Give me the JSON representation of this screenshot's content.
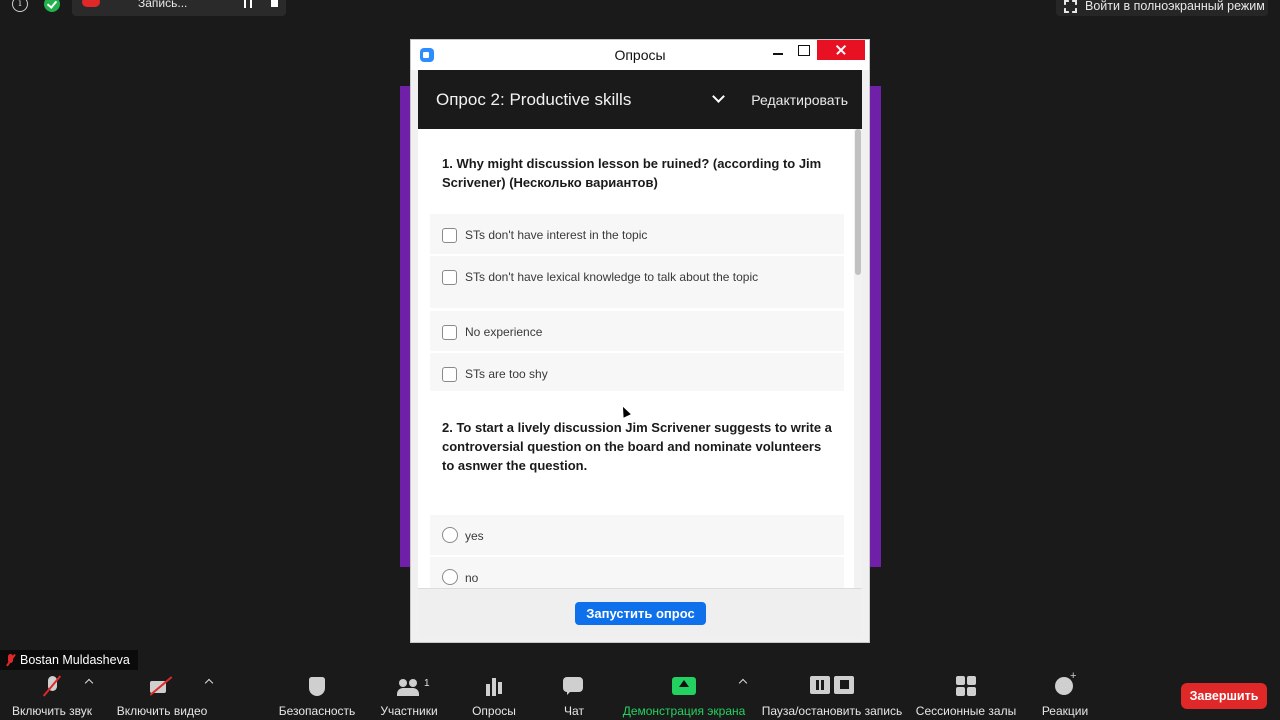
{
  "top_bar": {
    "recording_label": "Запись...",
    "fullscreen_label": "Войти в полноэкранный режим"
  },
  "poll_window": {
    "window_title": "Опросы",
    "poll_name": "Опрос 2: Productive skills",
    "edit_label": "Редактировать",
    "questions": [
      {
        "text": "1. Why might discussion lesson  be ruined? (according to Jim Scrivener) (Несколько вариантов)",
        "type": "multiple",
        "options": [
          "STs don't have interest in the topic",
          "STs don't have lexical knowledge to talk about the topic",
          "No experience",
          "STs are too shy"
        ]
      },
      {
        "text": "2. To start a lively discussion Jim Scrivener suggests to write a controversial question on the board and nominate volunteers to asnwer the question.",
        "type": "single",
        "options": [
          "yes",
          "no"
        ]
      }
    ],
    "launch_button": "Запустить опрос"
  },
  "participant": {
    "name": "Bostan Muldasheva"
  },
  "toolbar": {
    "audio": "Включить звук",
    "video": "Включить видео",
    "security": "Безопасность",
    "participants": "Участники",
    "participants_count": "1",
    "polls": "Опросы",
    "chat": "Чат",
    "share_screen": "Демонстрация экрана",
    "record": "Пауза/остановить запись",
    "breakout_rooms": "Сессионные залы",
    "reactions": "Реакции",
    "end": "Завершить"
  },
  "colors": {
    "accent_blue": "#0e71eb",
    "share_green": "#23d160",
    "end_red": "#e02828",
    "shared_screen_purple": "#6f1fa8"
  }
}
